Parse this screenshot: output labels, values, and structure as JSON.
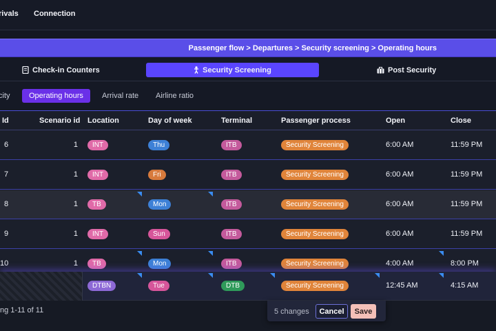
{
  "topnav": {
    "items": [
      "rivals",
      "Connection"
    ]
  },
  "breadcrumb": "Passenger flow > Departures > Security screening > Operating hours",
  "stages": [
    {
      "label": "Check-in Counters",
      "icon": "document-icon"
    },
    {
      "label": "Security Screening",
      "icon": "person-icon",
      "active": true
    },
    {
      "label": "Post Security",
      "icon": "luggage-icon"
    }
  ],
  "subtabs": [
    "city",
    "Operating hours",
    "Arrival rate",
    "Airline ratio"
  ],
  "table": {
    "columns": [
      "Id",
      "Scenario id",
      "Location",
      "Day of week",
      "Terminal",
      "Passenger process",
      "Open",
      "Close"
    ],
    "rows": [
      {
        "id": "6",
        "scenario": "1",
        "location": "INT",
        "day": "Thu",
        "terminal": "ITB",
        "process": "Security Screening",
        "open": "6:00 AM",
        "close": "11:59 PM"
      },
      {
        "id": "7",
        "scenario": "1",
        "location": "INT",
        "day": "Fri",
        "terminal": "ITB",
        "process": "Security Screening",
        "open": "6:00 AM",
        "close": "11:59 PM"
      },
      {
        "id": "8",
        "scenario": "1",
        "location": "TB",
        "day": "Mon",
        "terminal": "ITB",
        "process": "Security Screening",
        "open": "6:00 AM",
        "close": "11:59 PM"
      },
      {
        "id": "9",
        "scenario": "1",
        "location": "INT",
        "day": "Sun",
        "terminal": "ITB",
        "process": "Security Screening",
        "open": "6:00 AM",
        "close": "11:59 PM"
      },
      {
        "id": "10",
        "scenario": "1",
        "location": "TB",
        "day": "Mon",
        "terminal": "ITB",
        "process": "Security Screening",
        "open": "4:00 AM",
        "close": "8:00 PM"
      },
      {
        "id": "",
        "scenario": "",
        "location": "DTBN",
        "day": "Tue",
        "terminal": "DTB",
        "process": "Security Screening",
        "open": "12:45 AM",
        "close": "4:15 AM"
      }
    ]
  },
  "footer": {
    "count_text": "ng 1-11 of 11",
    "changes": "5 changes",
    "cancel": "Cancel",
    "save": "Save"
  },
  "colors": {
    "accent": "#5a45ff",
    "breadcrumb_bar": "#5a4ee8",
    "location_pill": "#e06aa8",
    "process_pill": "#e0843a"
  }
}
